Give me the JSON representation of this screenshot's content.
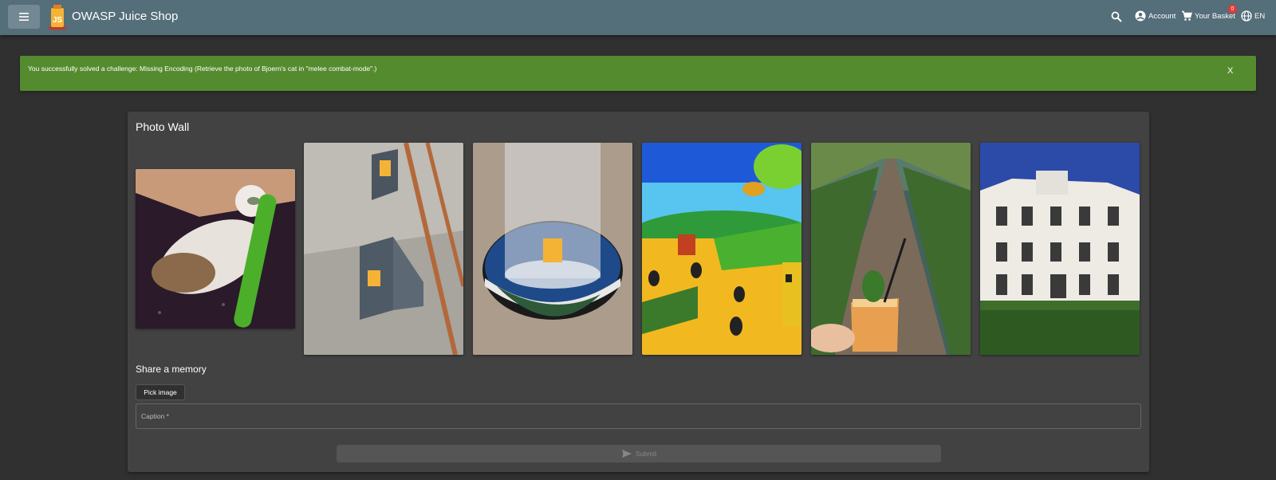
{
  "toolbar": {
    "title": "OWASP Juice Shop",
    "account_label": "Account",
    "basket_label": "Your Basket",
    "basket_count": "0",
    "language_label": "EN",
    "bg_color": "#546e7a"
  },
  "snackbar": {
    "message": "You successfully solved a challenge: Missing Encoding (Retrieve the photo of Bjoern's cat in \"melee combat-mode\".)",
    "close_label": "X",
    "bg_color": "#558b2f"
  },
  "photo_wall": {
    "title": "Photo Wall",
    "photos": [
      {
        "subject": "cat-with-green-toy"
      },
      {
        "subject": "juice-shop-stickers-on-wall"
      },
      {
        "subject": "glass-on-juice-shop-coaster"
      },
      {
        "subject": "bees-cartoon"
      },
      {
        "subject": "forest-path-with-drink"
      },
      {
        "subject": "white-building"
      }
    ]
  },
  "share": {
    "title": "Share a memory",
    "pick_image_label": "Pick image",
    "caption_placeholder": "Caption *",
    "submit_label": "Submit"
  }
}
